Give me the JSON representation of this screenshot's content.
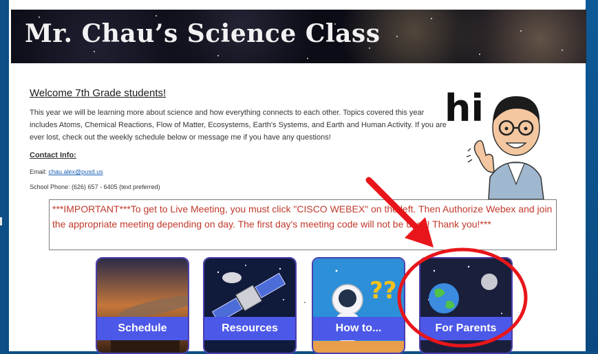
{
  "header": {
    "title": "Mr. Chau’s Science Class"
  },
  "welcome": {
    "heading": "Welcome 7th Grade students!",
    "intro": "This year we will be learning more about science and how everything connects to each other. Topics covered this year includes Atoms, Chemical Reactions, Flow of Matter, Ecosystems, Earth's Systems, and Earth and Human Activity.  If you are ever lost, check out the weekly schedule below or message me if you have any questions!"
  },
  "contact": {
    "heading": "Contact Info:",
    "email_label": "Email: ",
    "email": "chau.alex@pusd.us",
    "phone": "School Phone: (626) 657 - 6405 (text preferred)"
  },
  "bitmoji": {
    "greeting": "hi"
  },
  "notice": {
    "text": "***IMPORTANT***To get to Live Meeting, you must click \"CISCO WEBEX\" on the left. Then Authorize Webex and join the appropriate meeting depending on day. The first day's meeting code will not be used! Thank you!***"
  },
  "cards": [
    {
      "label": "Schedule",
      "icon": "saturn-ring-icon"
    },
    {
      "label": "Resources",
      "icon": "satellite-icon"
    },
    {
      "label": "How to...",
      "icon": "astronaut-icon"
    },
    {
      "label": "For Parents",
      "icon": "earth-moon-icon"
    }
  ],
  "annotation": {
    "arrow_color": "#e8161b",
    "ring_color": "#e8161b"
  },
  "colors": {
    "frame": "#0d4f86",
    "card_label": "#4c58e8",
    "notice_text": "#c0392b"
  }
}
